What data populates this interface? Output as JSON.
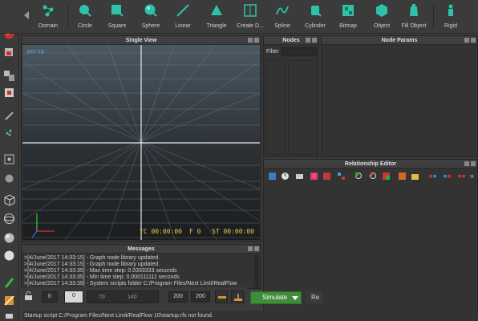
{
  "toolbar": {
    "items": [
      {
        "label": "Domain",
        "icon": "domain-icon"
      },
      {
        "label": "Circle",
        "icon": "circle-icon"
      },
      {
        "label": "Square",
        "icon": "square-icon"
      },
      {
        "label": "Sphere",
        "icon": "sphere-icon"
      },
      {
        "label": "Linear",
        "icon": "linear-icon"
      },
      {
        "label": "Triangle",
        "icon": "triangle-icon"
      },
      {
        "label": "Create D...",
        "icon": "create-domain-icon"
      },
      {
        "label": "Spline",
        "icon": "spline-icon"
      },
      {
        "label": "Cylinder",
        "icon": "cylinder-icon"
      },
      {
        "label": "Bitmap",
        "icon": "bitmap-icon"
      },
      {
        "label": "Object",
        "icon": "object-icon"
      },
      {
        "label": "Fill Object",
        "icon": "fill-object-icon"
      },
      {
        "label": "Rigid",
        "icon": "rigid-icon"
      }
    ]
  },
  "panels": {
    "single_view": {
      "title": "Single View",
      "view_label": "persp",
      "hud_tc": "TC 00:00:00",
      "hud_f": "F 0",
      "hud_st": "ST 00:00:00"
    },
    "nodes": {
      "title": "Nodes",
      "filter_label": "Filter",
      "filter_value": ""
    },
    "node_params": {
      "title": "Node Params"
    },
    "relationship_editor": {
      "title": "Relationship Editor"
    },
    "messages": {
      "title": "Messages",
      "lines": [
        ">[4/June/2017 14:33:15] - Graph node library updated.",
        ">[4/June/2017 14:33:15] - Graph node library updated.",
        ">[4/June/2017 14:33:35] - Max time step: 0.0333333 seconds",
        ">[4/June/2017 14:33:35] - Min time step: 0.000111111 seconds",
        ">[4/June/2017 14:33:39] - System scripts folder C:/Program Files/Next Limit/RealFlow"
      ]
    }
  },
  "timeline": {
    "start": "0",
    "current": "0",
    "ticks": [
      "70",
      "140"
    ],
    "end_a": "200",
    "end_b": "200"
  },
  "simulate": {
    "label": "Simulate",
    "reset_label": "Re"
  },
  "status": {
    "text": "Startup script C:/Program Files/Next Limit/RealFlow 10\\startup.rfs not found."
  },
  "colors": {
    "accent": "#3f8c3a",
    "hud": "#e6c84a",
    "icon_teal": "#2fc2a8"
  }
}
